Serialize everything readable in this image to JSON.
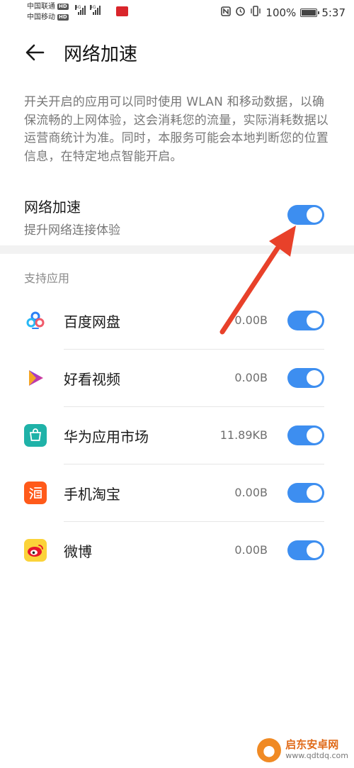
{
  "statusbar": {
    "carrier1": "中国联通",
    "carrier2": "中国移动",
    "hd_badge": "HD",
    "net_tag1": "4G",
    "net_tag2": "4G",
    "battery_percent": "100%",
    "time": "5:37"
  },
  "header": {
    "title": "网络加速"
  },
  "description": "开关开启的应用可以同时使用 WLAN 和移动数据，以确保流畅的上网体验，这会消耗您的流量，实际消耗数据以运营商统计为准。同时，本服务可能会本地判断您的位置信息，在特定地点智能开启。",
  "main_toggle": {
    "title": "网络加速",
    "subtitle": "提升网络连接体验",
    "on": true
  },
  "section": {
    "label": "支持应用"
  },
  "apps": [
    {
      "name": "百度网盘",
      "size": "0.00B",
      "on": true,
      "icon": "baidu-netdisk-icon"
    },
    {
      "name": "好看视频",
      "size": "0.00B",
      "on": true,
      "icon": "haokan-video-icon"
    },
    {
      "name": "华为应用市场",
      "size": "11.89KB",
      "on": true,
      "icon": "huawei-appgallery-icon"
    },
    {
      "name": "手机淘宝",
      "size": "0.00B",
      "on": true,
      "icon": "taobao-icon"
    },
    {
      "name": "微博",
      "size": "0.00B",
      "on": true,
      "icon": "weibo-icon"
    }
  ],
  "watermark": {
    "cn": "启东安卓网",
    "url": "www.qdtdq.com"
  },
  "colors": {
    "accent": "#3d8ef0",
    "annotation": "#e8412a"
  }
}
